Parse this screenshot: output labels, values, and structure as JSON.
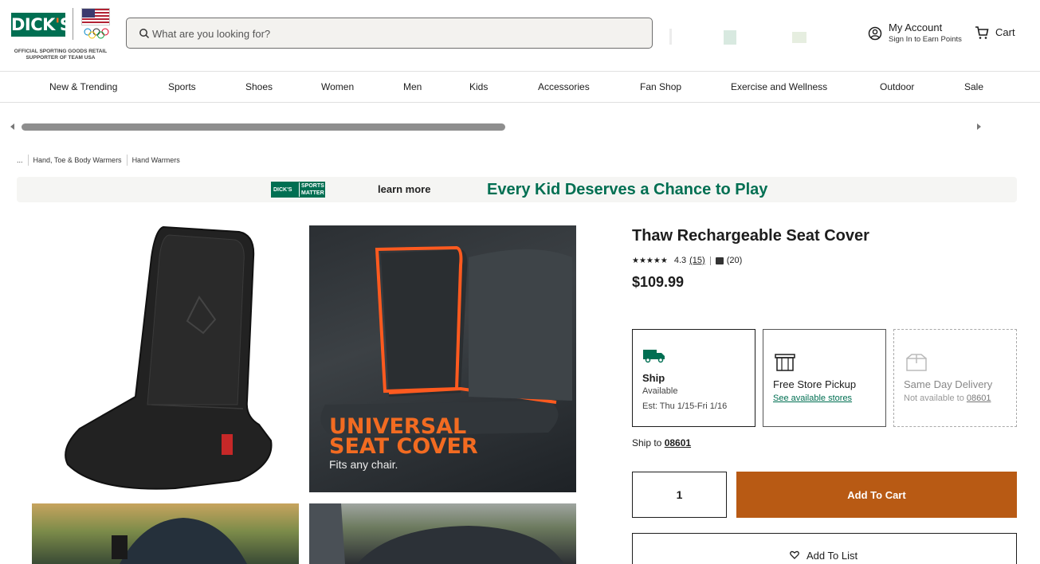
{
  "brand": {
    "logo_text": "DICK'S",
    "tagline": "OFFICIAL SPORTING GOODS RETAIL SUPPORTER OF TEAM USA",
    "brand_color": "#006f52",
    "accent_color": "#f26b21"
  },
  "search": {
    "placeholder": "What are you looking for?",
    "icon": "search-icon"
  },
  "account": {
    "title": "My Account",
    "subtitle": "Sign In to Earn Points",
    "icon": "user-circle-icon"
  },
  "cart": {
    "label": "Cart",
    "icon": "cart-icon"
  },
  "nav": {
    "items": [
      "New & Trending",
      "Sports",
      "Shoes",
      "Women",
      "Men",
      "Kids",
      "Accessories",
      "Fan Shop",
      "Exercise and Wellness",
      "Outdoor",
      "Sale"
    ]
  },
  "breadcrumb": {
    "ellipsis": "...",
    "items": [
      "Hand, Toe & Body Warmers",
      "Hand Warmers"
    ]
  },
  "banner": {
    "logo_line1": "DICK'S",
    "logo_line2": "SPORTS MATTER",
    "learn_more": "learn more",
    "slogan": "Every Kid Deserves a Chance to Play"
  },
  "gallery": {
    "image2_title_line1": "UNIVERSAL",
    "image2_title_line2": "SEAT COVER",
    "image2_subtitle": "Fits any chair."
  },
  "product": {
    "title": "Thaw Rechargeable Seat Cover",
    "rating": 4.3,
    "rating_text": "4.3",
    "review_count": "(15)",
    "qa_count": "(20)",
    "price": "$109.99"
  },
  "fulfillment": {
    "ship": {
      "title": "Ship",
      "status": "Available",
      "estimate": "Est: Thu 1/15-Fri 1/16",
      "icon": "truck-icon"
    },
    "pickup": {
      "title": "Free Store Pickup",
      "link": "See available stores",
      "icon": "store-icon"
    },
    "same_day": {
      "title": "Same Day Delivery",
      "status_prefix": "Not available to ",
      "zip": "08601",
      "icon": "delivery-box-icon"
    }
  },
  "ship_to": {
    "label": "Ship to ",
    "zip": "08601"
  },
  "quantity": {
    "value": "1"
  },
  "buttons": {
    "add_to_cart": "Add To Cart",
    "add_to_list": "Add To List",
    "add_to_cart_color": "#b85a14"
  }
}
